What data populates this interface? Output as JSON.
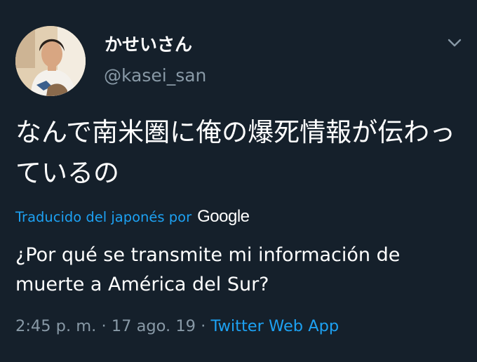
{
  "tweet": {
    "display_name": "かせいさん",
    "username": "@kasei_san",
    "text": "なんで南米圏に俺の爆死情報が伝わっているの",
    "translation": {
      "label": "Traducido del japonés por",
      "provider": "Google",
      "text": "¿Por qué se transmite mi información de muerte a América del Sur?"
    },
    "time": "2:45 p. m.",
    "separator": " · ",
    "date": "17 ago. 19",
    "source": "Twitter Web App"
  },
  "icons": {
    "menu": "chevron-down-icon"
  },
  "colors": {
    "background": "#15202b",
    "primary_text": "#ffffff",
    "secondary_text": "#8899a6",
    "accent": "#1da1f2"
  }
}
